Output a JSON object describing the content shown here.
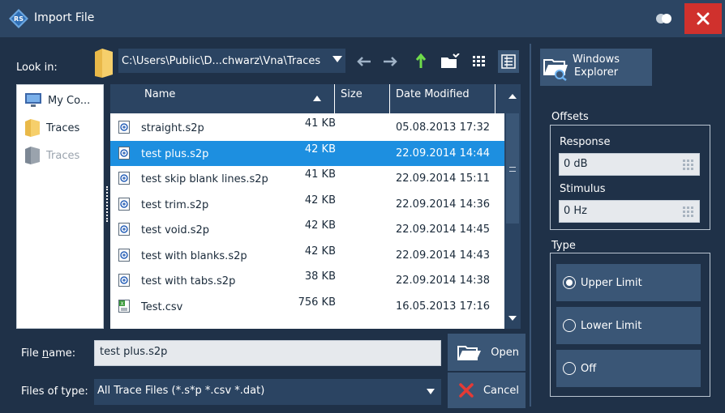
{
  "window": {
    "title": "Import File",
    "close_symbol": "✕"
  },
  "lookin": {
    "label": "Look in:",
    "path": "C:\\Users\\Public\\D...chwarz\\Vna\\Traces"
  },
  "sidebar": {
    "items": [
      {
        "label": "My Co...",
        "icon": "computer-icon",
        "enabled": true
      },
      {
        "label": "Traces",
        "icon": "folder-icon",
        "enabled": true
      },
      {
        "label": "Traces",
        "icon": "folder-icon",
        "enabled": false
      }
    ]
  },
  "filelist": {
    "columns": {
      "name": "Name",
      "size": "Size",
      "date": "Date Modified"
    },
    "selected_index": 1,
    "rows": [
      {
        "name": "straight.s2p",
        "size": "41 KB",
        "date": "05.08.2013 17:32",
        "icon": "s2p-file-icon"
      },
      {
        "name": "test plus.s2p",
        "size": "42 KB",
        "date": "22.09.2014 14:44",
        "icon": "s2p-file-icon"
      },
      {
        "name": "test skip blank lines.s2p",
        "size": "41 KB",
        "date": "22.09.2014 15:11",
        "icon": "s2p-file-icon"
      },
      {
        "name": "test trim.s2p",
        "size": "42 KB",
        "date": "22.09.2014 14:36",
        "icon": "s2p-file-icon"
      },
      {
        "name": "test void.s2p",
        "size": "42 KB",
        "date": "22.09.2014 14:45",
        "icon": "s2p-file-icon"
      },
      {
        "name": "test with blanks.s2p",
        "size": "42 KB",
        "date": "22.09.2014 14:43",
        "icon": "s2p-file-icon"
      },
      {
        "name": "test with tabs.s2p",
        "size": "38 KB",
        "date": "22.09.2014 14:38",
        "icon": "s2p-file-icon"
      },
      {
        "name": "Test.csv",
        "size": "756 KB",
        "date": "16.05.2013 17:16",
        "icon": "csv-file-icon"
      }
    ]
  },
  "filename": {
    "label_pre": "File ",
    "label_u": "n",
    "label_post": "ame:",
    "value": "test plus.s2p"
  },
  "filetype": {
    "label": "Files of type:",
    "value": "All Trace Files (*.s*p *.csv *.dat)"
  },
  "buttons": {
    "open": "Open",
    "cancel": "Cancel",
    "explorer_line1": "Windows",
    "explorer_line2": "Explorer"
  },
  "offsets": {
    "group_label": "Offsets",
    "response_label": "Response",
    "response_value": "0 dB",
    "stimulus_label": "Stimulus",
    "stimulus_value": "0 Hz"
  },
  "type": {
    "group_label": "Type",
    "options": [
      {
        "label": "Upper Limit",
        "checked": true
      },
      {
        "label": "Lower Limit",
        "checked": false
      },
      {
        "label": "Off",
        "checked": false
      }
    ]
  },
  "colors": {
    "accent": "#1d8fe0",
    "panel": "#1f3148",
    "button": "#3a5676",
    "close": "#d0312d"
  }
}
